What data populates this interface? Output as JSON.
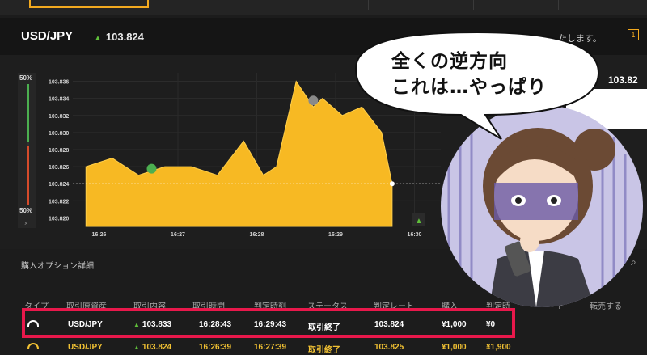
{
  "header": {
    "pair": "USD/JPY",
    "rate": "103.824",
    "notice_tail": "たします。",
    "notice_icon": "1",
    "right_rate": "103.82"
  },
  "chart": {
    "left_top_pct": "50%",
    "left_bottom_pct": "50%",
    "left_close": "×"
  },
  "chart_data": {
    "type": "area",
    "y_ticks": [
      "103.836",
      "103.834",
      "103.832",
      "103.830",
      "103.828",
      "103.826",
      "103.824",
      "103.822",
      "103.820"
    ],
    "x_ticks": [
      "16:26",
      "16:27",
      "16:28",
      "16:29",
      "16:30"
    ],
    "ylim": [
      103.819,
      103.837
    ],
    "series": [
      {
        "x": [
          "16:25:50",
          "16:26:10",
          "16:26:30",
          "16:26:50",
          "16:27:10",
          "16:27:30",
          "16:27:50",
          "16:28:05",
          "16:28:15",
          "16:28:30",
          "16:28:43",
          "16:28:50",
          "16:29:05",
          "16:29:20",
          "16:29:35",
          "16:29:43"
        ],
        "y": [
          103.826,
          103.827,
          103.825,
          103.826,
          103.826,
          103.825,
          103.829,
          103.825,
          103.826,
          103.836,
          103.833,
          103.834,
          103.832,
          103.833,
          103.83,
          103.824
        ]
      }
    ],
    "entry_marker": {
      "x": "16:26:40",
      "y": 103.825,
      "direction": "up"
    },
    "mid_marker": {
      "x": "16:28:43",
      "y": 103.833
    },
    "current_rate": 103.824
  },
  "section": {
    "title": "購入オプション詳細"
  },
  "table": {
    "headers": [
      "タイプ",
      "取引原資産",
      "取引内容",
      "取引時間",
      "判定時刻",
      "ステータス",
      "判定レート",
      "購入",
      "判定時",
      "ト",
      "転売する"
    ],
    "rows": [
      {
        "asset": "USD/JPY",
        "content": "103.833",
        "time": "16:28:43",
        "judge_time": "16:29:43",
        "status": "取引終了",
        "judge_rate": "103.824",
        "purchase": "¥1,000",
        "result": "¥0"
      },
      {
        "asset": "USD/JPY",
        "content": "103.824",
        "time": "16:26:39",
        "judge_time": "16:27:39",
        "status": "取引終了",
        "judge_rate": "103.825",
        "purchase": "¥1,000",
        "result": "¥1,900"
      }
    ]
  },
  "overlay": {
    "bubble_line1": "全くの逆方向",
    "bubble_line2": "これは…やっぱり"
  },
  "colors": {
    "accent": "#f2a91f",
    "area_fill": "#f7b923",
    "up": "#5fbf3a",
    "down": "#e0402f",
    "highlight": "#e8184b"
  }
}
